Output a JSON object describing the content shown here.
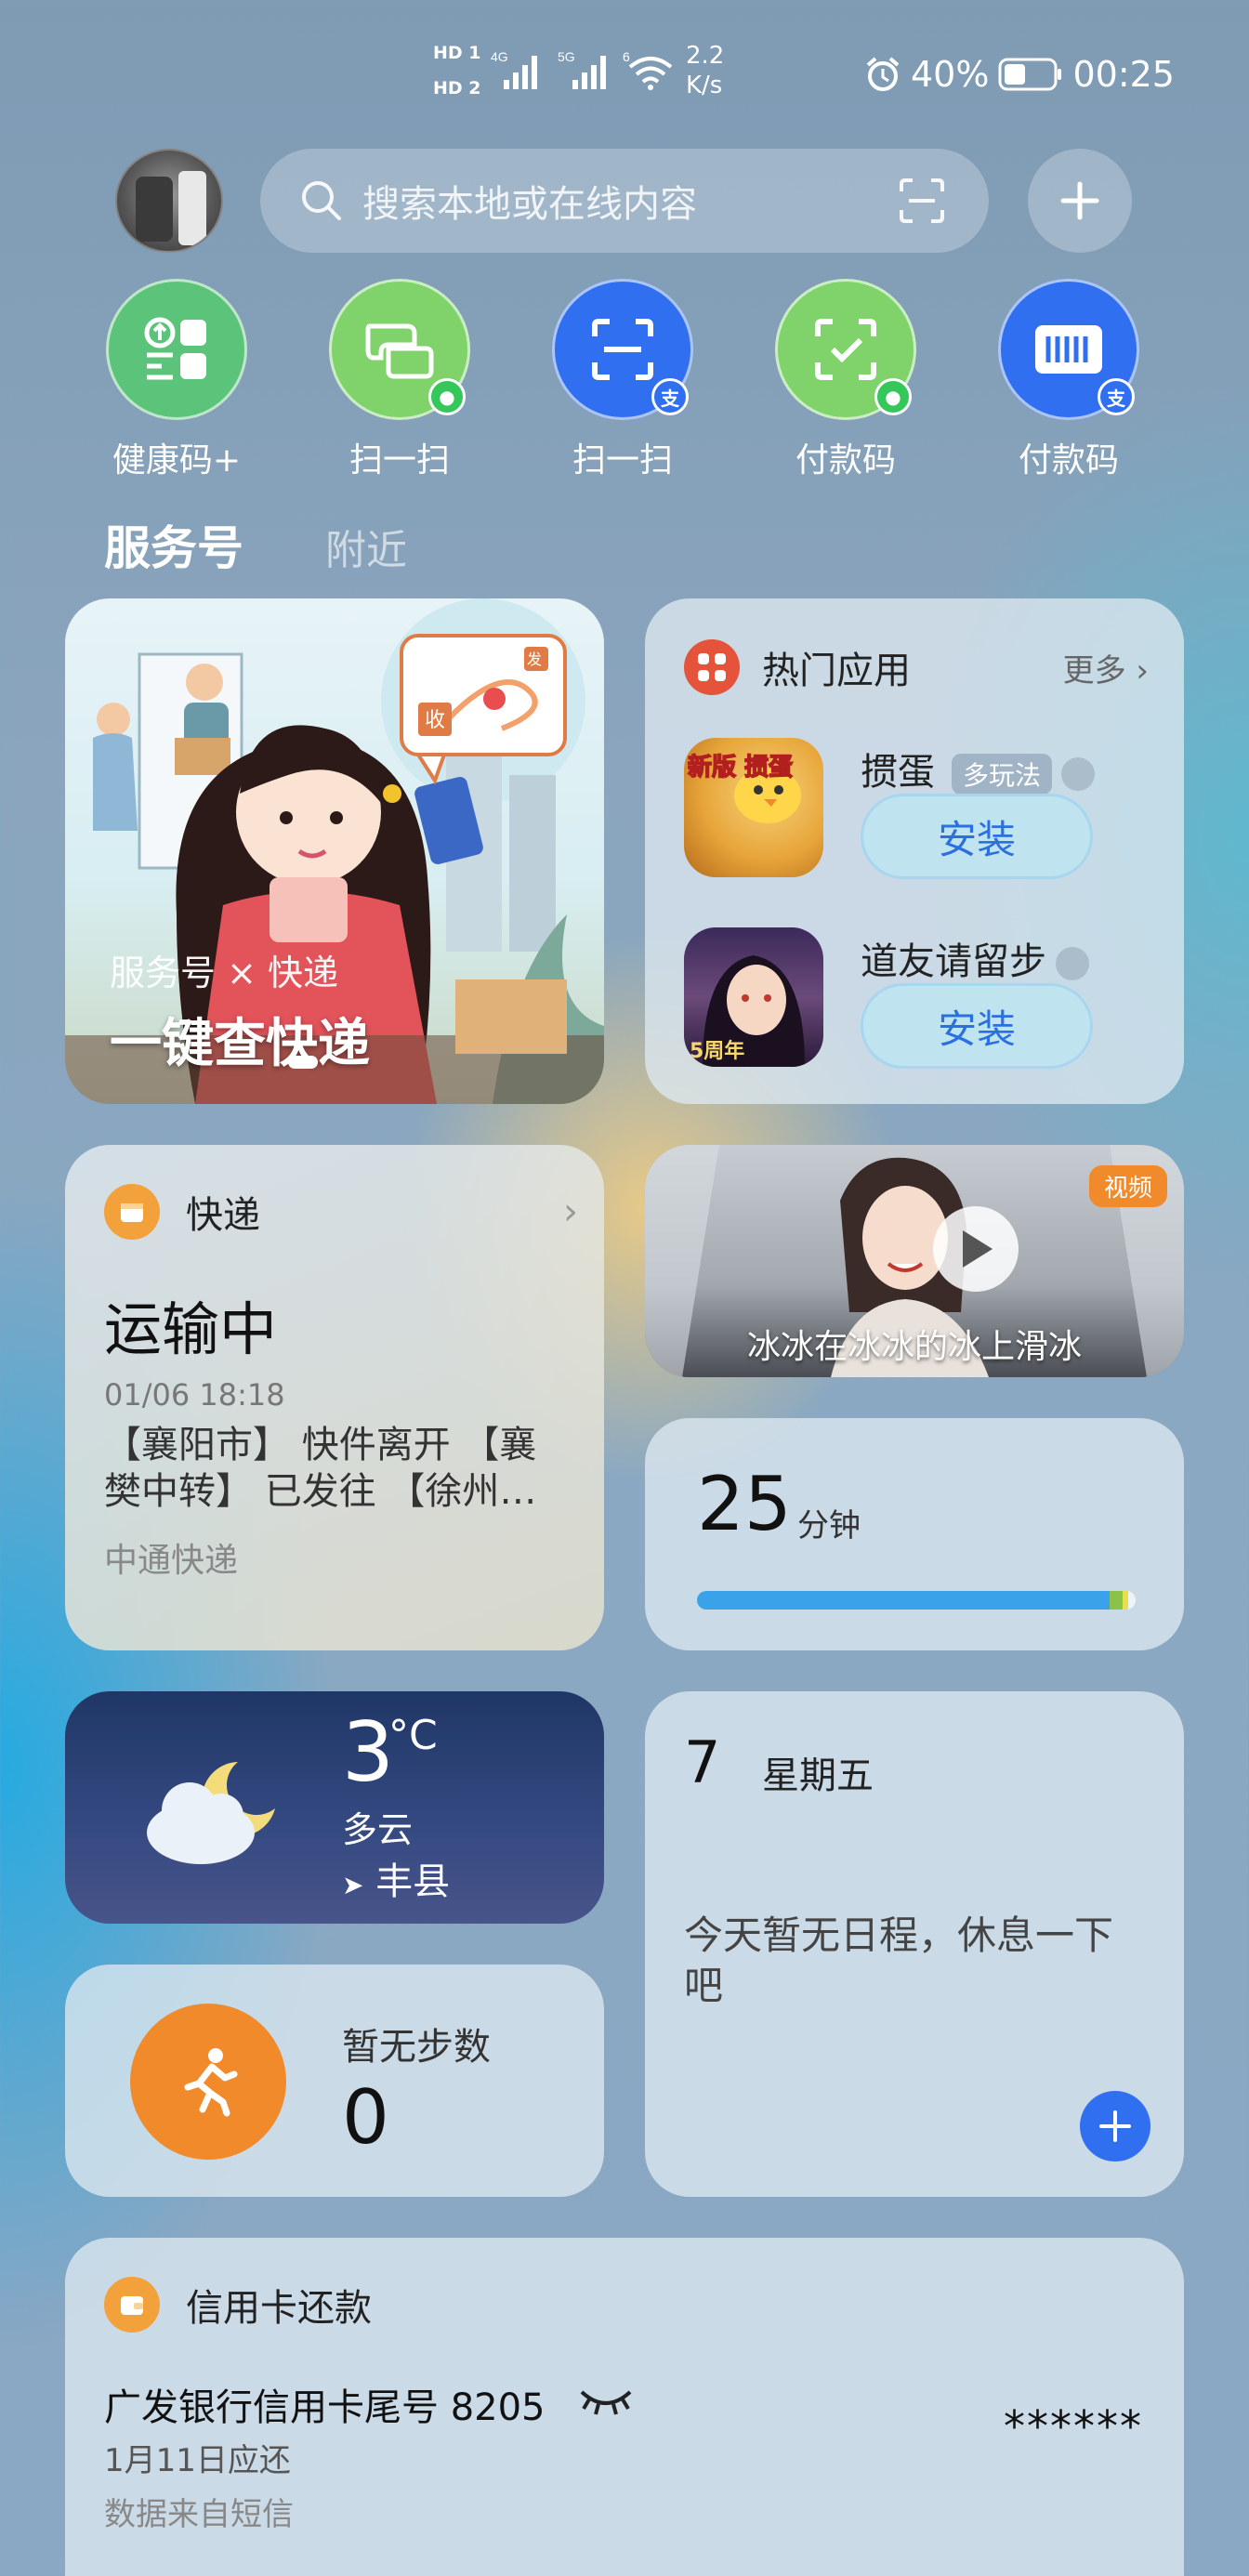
{
  "status_bar": {
    "sim1": "HD 1",
    "sim2": "HD 2",
    "net1": "4G",
    "net2": "5G",
    "wifi_gen": "6",
    "speed_value": "2.2",
    "speed_unit": "K/s",
    "battery": "40%",
    "time": "00:25"
  },
  "search": {
    "placeholder": "搜索本地或在线内容"
  },
  "quick_actions": [
    {
      "label": "健康码+",
      "color": "#5cc37a",
      "icon": "health-code-icon",
      "badge": ""
    },
    {
      "label": "扫一扫",
      "color": "#7fd36a",
      "icon": "wechat-scan-icon",
      "badge": "wechat"
    },
    {
      "label": "扫一扫",
      "color": "#2f6ff0",
      "icon": "alipay-scan-icon",
      "badge": "支"
    },
    {
      "label": "付款码",
      "color": "#7fd36a",
      "icon": "wechat-pay-icon",
      "badge": "wechat"
    },
    {
      "label": "付款码",
      "color": "#2f6ff0",
      "icon": "alipay-pay-icon",
      "badge": "支"
    }
  ],
  "tabs": {
    "active": "服务号",
    "inactive": "附近"
  },
  "banner": {
    "caption": "服务号 × 快递",
    "title": "一键查快递",
    "sign_send": "发",
    "sign_receive": "收"
  },
  "hot_apps": {
    "title": "热门应用",
    "more": "更多",
    "apps": [
      {
        "name": "掼蛋",
        "tag": "多玩法",
        "button": "安装",
        "art_text": "新版 掼蛋"
      },
      {
        "name": "道友请留步",
        "tag": "",
        "button": "安装",
        "art_text": "5周年"
      }
    ]
  },
  "express": {
    "title": "快递",
    "status": "运输中",
    "time": "01/06 18:18",
    "detail": "【襄阳市】 快件离开 【襄樊中转】 已发往 【徐州…",
    "company": "中通快递"
  },
  "video": {
    "badge": "视频",
    "caption": "冰冰在冰冰的冰上滑冰"
  },
  "screen_time": {
    "value": "25",
    "unit": "分钟",
    "progress": 0.94
  },
  "weather": {
    "temp": "3",
    "unit": "°C",
    "condition": "多云",
    "location": "丰县"
  },
  "steps": {
    "label": "暂无步数",
    "count": "0"
  },
  "calendar": {
    "day": "7",
    "weekday": "星期五",
    "empty": "今天暂无日程，休息一下吧"
  },
  "credit_card": {
    "title": "信用卡还款",
    "bank": "广发银行信用卡尾号 8205",
    "due": "1月11日应还",
    "source": "数据来自短信",
    "amount": "******"
  }
}
